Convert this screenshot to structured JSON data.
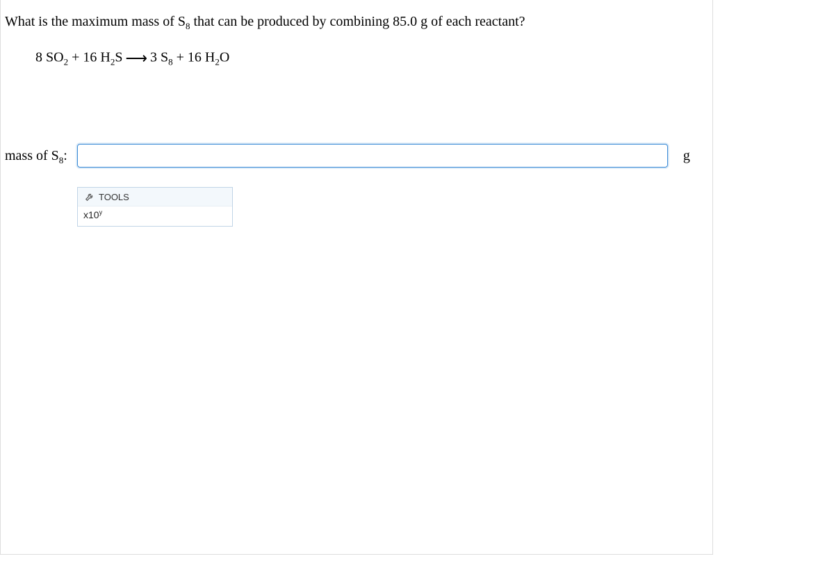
{
  "question": {
    "prefix": "What is the maximum mass of S",
    "sub1": "8",
    "suffix": " that can be produced by combining 85.0 g of each reactant?"
  },
  "equation": {
    "c1": "8",
    "r1": "SO",
    "r1sub": "2",
    "plus1": " + ",
    "c2": "16",
    "r2a": "H",
    "r2a_sub": "2",
    "r2b": "S",
    "arrow": " ⟶ ",
    "c3": "3",
    "p1": "S",
    "p1sub": "8",
    "plus2": " + ",
    "c4": "16",
    "p2a": "H",
    "p2a_sub": "2",
    "p2b": "O"
  },
  "input_label": {
    "prefix": "mass of S",
    "sub": "8",
    "suffix": ":"
  },
  "answer_value": "",
  "unit": "g",
  "tools": {
    "header": "TOOLS",
    "button_base": "x10",
    "button_sup": "y"
  }
}
